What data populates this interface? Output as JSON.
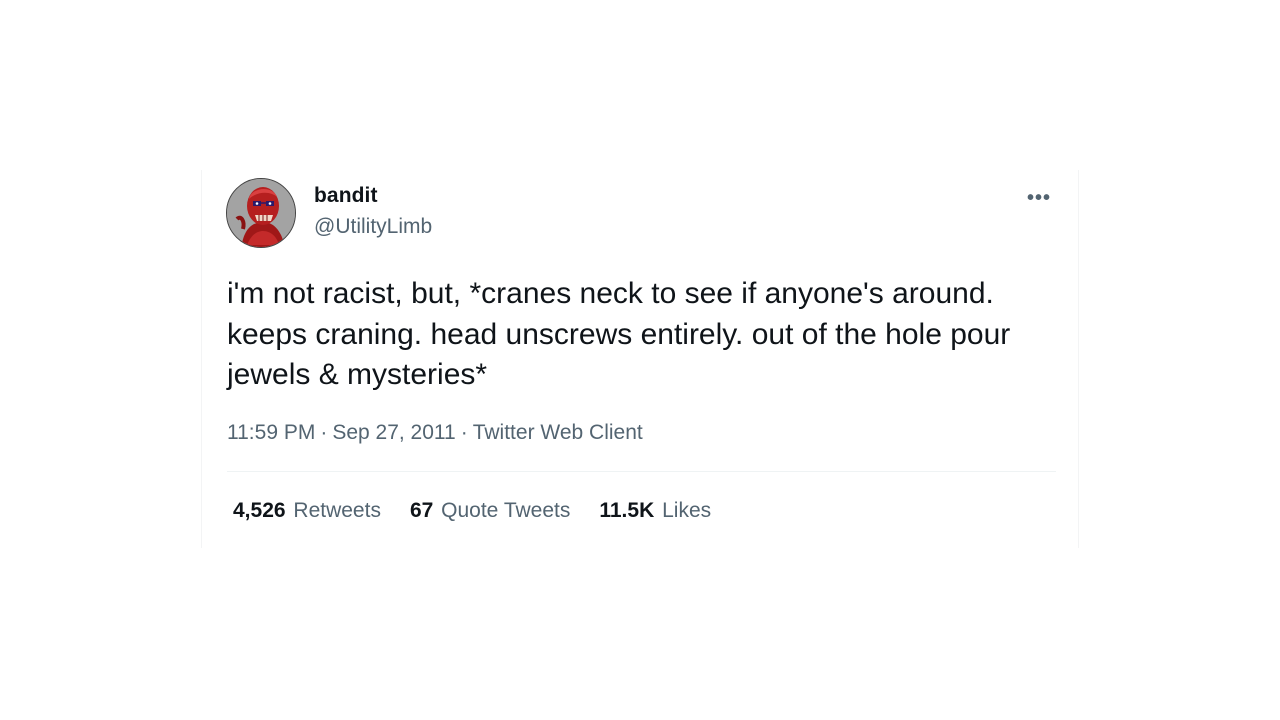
{
  "user": {
    "display_name": "bandit",
    "handle": "@UtilityLimb",
    "avatar_icon": "red-creature-avatar"
  },
  "tweet": {
    "text": "i'm not racist, but, *cranes neck to see if anyone's around. keeps craning. head unscrews entirely. out of the hole pour jewels & mysteries*",
    "time": "11:59 PM",
    "separator": "·",
    "date": "Sep 27, 2011",
    "client": "Twitter Web Client"
  },
  "stats": {
    "retweets": {
      "count": "4,526",
      "label": "Retweets"
    },
    "quote_tweets": {
      "count": "67",
      "label": "Quote Tweets"
    },
    "likes": {
      "count": "11.5K",
      "label": "Likes"
    }
  },
  "more_menu_icon": "more-dots-icon",
  "colors": {
    "primary_text": "#0f1419",
    "secondary_text": "#536471",
    "divider": "#eff3f4",
    "background": "#ffffff"
  }
}
